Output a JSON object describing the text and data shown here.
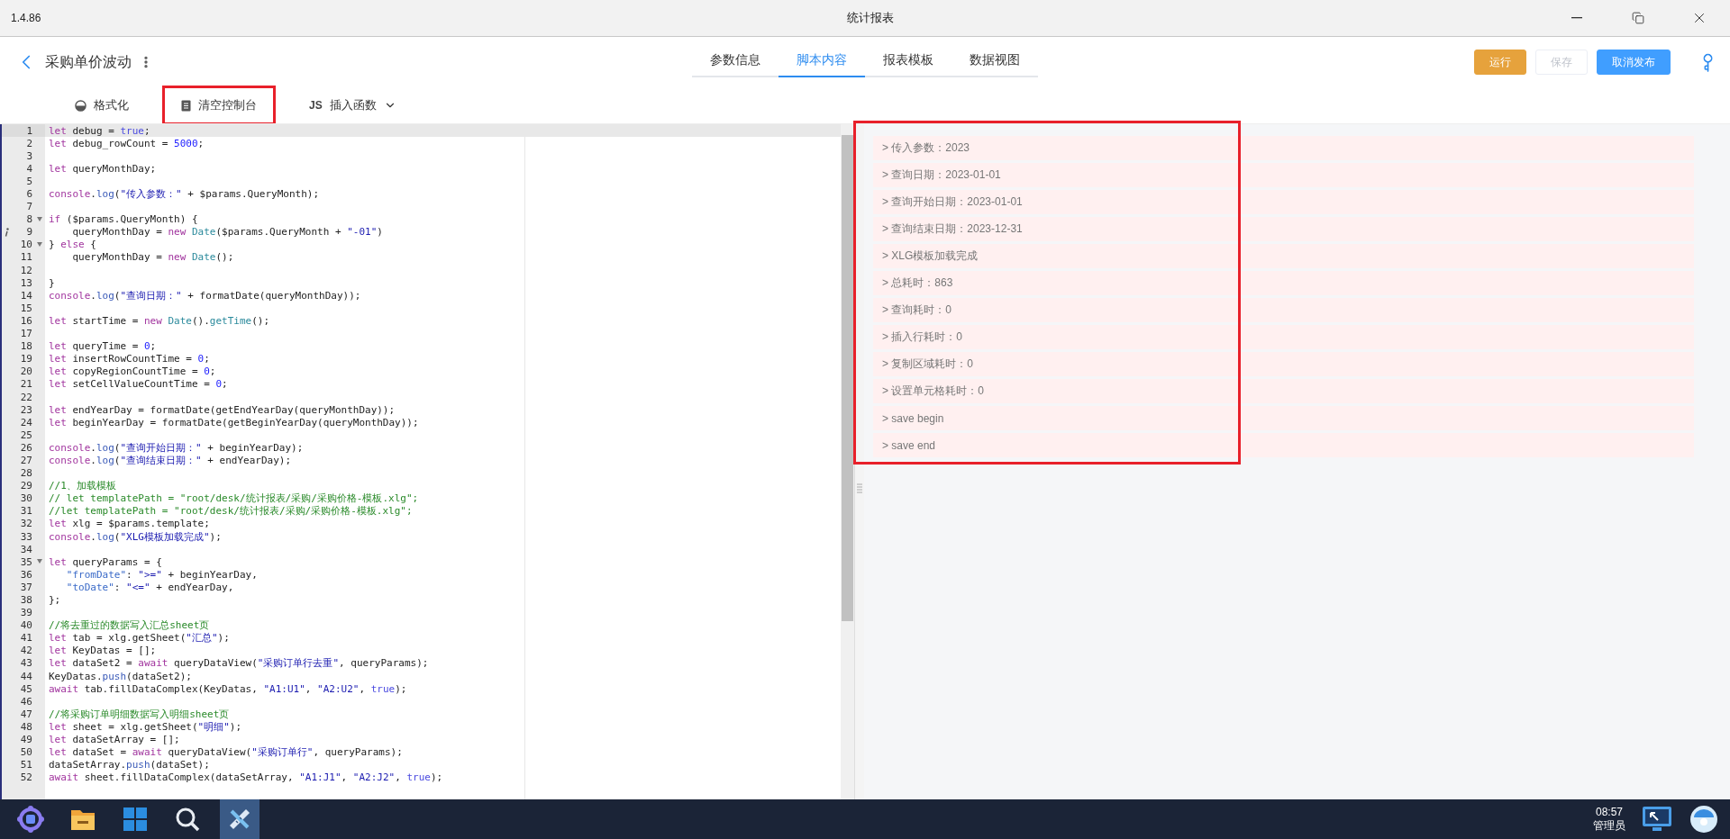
{
  "window": {
    "version": "1.4.86",
    "title": "统计报表"
  },
  "header": {
    "title": "采购单价波动"
  },
  "tabs": [
    {
      "label": "参数信息",
      "selected": false
    },
    {
      "label": "脚本内容",
      "selected": true
    },
    {
      "label": "报表模板",
      "selected": false
    },
    {
      "label": "数据视图",
      "selected": false
    }
  ],
  "actions": [
    {
      "label": "运行",
      "kind": "warning",
      "disabled": false
    },
    {
      "label": "保存",
      "kind": "plain",
      "disabled": true
    },
    {
      "label": "取消发布",
      "kind": "primary",
      "disabled": false
    }
  ],
  "toolbar": [
    {
      "kind": "format",
      "label": "格式化",
      "highlighted": false
    },
    {
      "kind": "clear",
      "label": "清空控制台",
      "highlighted": true
    },
    {
      "kind": "insert",
      "icon_text": "JS",
      "label": "插入函数",
      "highlighted": false
    }
  ],
  "code_lines": [
    {
      "number": "1",
      "active": true,
      "tokens": [
        {
          "kind": "kw",
          "text": "let"
        },
        {
          "kind": "txt",
          "text": " debug = "
        },
        {
          "kind": "atom",
          "text": "true"
        },
        {
          "kind": "txt",
          "text": ";"
        }
      ]
    },
    {
      "number": "2",
      "tokens": [
        {
          "kind": "kw",
          "text": "let"
        },
        {
          "kind": "txt",
          "text": " debug_rowCount = "
        },
        {
          "kind": "num",
          "text": "5000"
        },
        {
          "kind": "txt",
          "text": ";"
        }
      ]
    },
    {
      "number": "3"
    },
    {
      "number": "4",
      "tokens": [
        {
          "kind": "kw",
          "text": "let"
        },
        {
          "kind": "txt",
          "text": " queryMonthDay;"
        }
      ]
    },
    {
      "number": "5"
    },
    {
      "number": "6",
      "tokens": [
        {
          "kind": "kw",
          "text": "console"
        },
        {
          "kind": "txt",
          "text": "."
        },
        {
          "kind": "fn",
          "text": "log"
        },
        {
          "kind": "txt",
          "text": "("
        },
        {
          "kind": "str",
          "text": "\"传入参数：\""
        },
        {
          "kind": "txt",
          "text": " + $params.QueryMonth);"
        }
      ]
    },
    {
      "number": "7"
    },
    {
      "number": "8",
      "fold": true,
      "tokens": [
        {
          "kind": "kw",
          "text": "if"
        },
        {
          "kind": "txt",
          "text": " ($params.QueryMonth) {"
        }
      ]
    },
    {
      "number": "9",
      "info": true,
      "tokens": [
        {
          "kind": "txt",
          "text": "    queryMonthDay = "
        },
        {
          "kind": "kw",
          "text": "new"
        },
        {
          "kind": "cls",
          "text": " Date"
        },
        {
          "kind": "txt",
          "text": "($params.QueryMonth + "
        },
        {
          "kind": "str",
          "text": "\"-01\""
        },
        {
          "kind": "txt",
          "text": ")"
        }
      ]
    },
    {
      "number": "10",
      "fold": true,
      "tokens": [
        {
          "kind": "txt",
          "text": "} "
        },
        {
          "kind": "kw",
          "text": "else"
        },
        {
          "kind": "txt",
          "text": " {"
        }
      ]
    },
    {
      "number": "11",
      "tokens": [
        {
          "kind": "txt",
          "text": "    queryMonthDay = "
        },
        {
          "kind": "kw",
          "text": "new"
        },
        {
          "kind": "cls",
          "text": " Date"
        },
        {
          "kind": "txt",
          "text": "();"
        }
      ]
    },
    {
      "number": "12"
    },
    {
      "number": "13",
      "tokens": [
        {
          "kind": "txt",
          "text": "}"
        }
      ]
    },
    {
      "number": "14",
      "tokens": [
        {
          "kind": "kw",
          "text": "console"
        },
        {
          "kind": "txt",
          "text": "."
        },
        {
          "kind": "fn",
          "text": "log"
        },
        {
          "kind": "txt",
          "text": "("
        },
        {
          "kind": "str",
          "text": "\"查询日期：\""
        },
        {
          "kind": "txt",
          "text": " + formatDate(queryMonthDay));"
        }
      ]
    },
    {
      "number": "15"
    },
    {
      "number": "16",
      "tokens": [
        {
          "kind": "kw",
          "text": "let"
        },
        {
          "kind": "txt",
          "text": " startTime = "
        },
        {
          "kind": "kw",
          "text": "new"
        },
        {
          "kind": "cls",
          "text": " Date"
        },
        {
          "kind": "txt",
          "text": "()."
        },
        {
          "kind": "cls",
          "text": "getTime"
        },
        {
          "kind": "txt",
          "text": "();"
        }
      ]
    },
    {
      "number": "17"
    },
    {
      "number": "18",
      "tokens": [
        {
          "kind": "kw",
          "text": "let"
        },
        {
          "kind": "txt",
          "text": " queryTime = "
        },
        {
          "kind": "num",
          "text": "0"
        },
        {
          "kind": "txt",
          "text": ";"
        }
      ]
    },
    {
      "number": "19",
      "tokens": [
        {
          "kind": "kw",
          "text": "let"
        },
        {
          "kind": "txt",
          "text": " insertRowCountTime = "
        },
        {
          "kind": "num",
          "text": "0"
        },
        {
          "kind": "txt",
          "text": ";"
        }
      ]
    },
    {
      "number": "20",
      "tokens": [
        {
          "kind": "kw",
          "text": "let"
        },
        {
          "kind": "txt",
          "text": " copyRegionCountTime = "
        },
        {
          "kind": "num",
          "text": "0"
        },
        {
          "kind": "txt",
          "text": ";"
        }
      ]
    },
    {
      "number": "21",
      "tokens": [
        {
          "kind": "kw",
          "text": "let"
        },
        {
          "kind": "txt",
          "text": " setCellValueCountTime = "
        },
        {
          "kind": "num",
          "text": "0"
        },
        {
          "kind": "txt",
          "text": ";"
        }
      ]
    },
    {
      "number": "22"
    },
    {
      "number": "23",
      "tokens": [
        {
          "kind": "kw",
          "text": "let"
        },
        {
          "kind": "txt",
          "text": " endYearDay = formatDate(getEndYearDay(queryMonthDay));"
        }
      ]
    },
    {
      "number": "24",
      "tokens": [
        {
          "kind": "kw",
          "text": "let"
        },
        {
          "kind": "txt",
          "text": " beginYearDay = formatDate(getBeginYearDay(queryMonthDay));"
        }
      ]
    },
    {
      "number": "25"
    },
    {
      "number": "26",
      "tokens": [
        {
          "kind": "kw",
          "text": "console"
        },
        {
          "kind": "txt",
          "text": "."
        },
        {
          "kind": "fn",
          "text": "log"
        },
        {
          "kind": "txt",
          "text": "("
        },
        {
          "kind": "str",
          "text": "\"查询开始日期：\""
        },
        {
          "kind": "txt",
          "text": " + beginYearDay);"
        }
      ]
    },
    {
      "number": "27",
      "tokens": [
        {
          "kind": "kw",
          "text": "console"
        },
        {
          "kind": "txt",
          "text": "."
        },
        {
          "kind": "fn",
          "text": "log"
        },
        {
          "kind": "txt",
          "text": "("
        },
        {
          "kind": "str",
          "text": "\"查询结束日期：\""
        },
        {
          "kind": "txt",
          "text": " + endYearDay);"
        }
      ]
    },
    {
      "number": "28"
    },
    {
      "number": "29",
      "tokens": [
        {
          "kind": "cmt",
          "text": "//1、加载模板"
        }
      ]
    },
    {
      "number": "30",
      "tokens": [
        {
          "kind": "cmt",
          "text": "// let templatePath = \"root/desk/统计报表/采购/采购价格-模板.xlg\";"
        }
      ]
    },
    {
      "number": "31",
      "tokens": [
        {
          "kind": "cmt",
          "text": "//let templatePath = \"root/desk/统计报表/采购/采购价格-模板.xlg\";"
        }
      ]
    },
    {
      "number": "32",
      "tokens": [
        {
          "kind": "kw",
          "text": "let"
        },
        {
          "kind": "txt",
          "text": " xlg = $params.template;"
        }
      ]
    },
    {
      "number": "33",
      "tokens": [
        {
          "kind": "kw",
          "text": "console"
        },
        {
          "kind": "txt",
          "text": "."
        },
        {
          "kind": "fn",
          "text": "log"
        },
        {
          "kind": "txt",
          "text": "("
        },
        {
          "kind": "str",
          "text": "\"XLG模板加载完成\""
        },
        {
          "kind": "txt",
          "text": ");"
        }
      ]
    },
    {
      "number": "34"
    },
    {
      "number": "35",
      "fold": true,
      "tokens": [
        {
          "kind": "kw",
          "text": "let"
        },
        {
          "kind": "txt",
          "text": " queryParams = {"
        }
      ]
    },
    {
      "number": "36",
      "tokens": [
        {
          "kind": "key",
          "text": "   \"fromDate\""
        },
        {
          "kind": "txt",
          "text": ": "
        },
        {
          "kind": "str",
          "text": "\">=\""
        },
        {
          "kind": "txt",
          "text": " + beginYearDay,"
        }
      ]
    },
    {
      "number": "37",
      "tokens": [
        {
          "kind": "key",
          "text": "   \"toDate\""
        },
        {
          "kind": "txt",
          "text": ": "
        },
        {
          "kind": "str",
          "text": "\"<=\""
        },
        {
          "kind": "txt",
          "text": " + endYearDay,"
        }
      ]
    },
    {
      "number": "38",
      "tokens": [
        {
          "kind": "txt",
          "text": "};"
        }
      ]
    },
    {
      "number": "39"
    },
    {
      "number": "40",
      "tokens": [
        {
          "kind": "cmt",
          "text": "//将去重过的数据写入汇总sheet页"
        }
      ]
    },
    {
      "number": "41",
      "tokens": [
        {
          "kind": "kw",
          "text": "let"
        },
        {
          "kind": "txt",
          "text": " tab = xlg.getSheet("
        },
        {
          "kind": "str",
          "text": "\"汇总\""
        },
        {
          "kind": "txt",
          "text": ");"
        }
      ]
    },
    {
      "number": "42",
      "tokens": [
        {
          "kind": "kw",
          "text": "let"
        },
        {
          "kind": "txt",
          "text": " KeyDatas = [];"
        }
      ]
    },
    {
      "number": "43",
      "tokens": [
        {
          "kind": "kw",
          "text": "let"
        },
        {
          "kind": "txt",
          "text": " dataSet2 = "
        },
        {
          "kind": "kw",
          "text": "await"
        },
        {
          "kind": "txt",
          "text": " queryDataView("
        },
        {
          "kind": "str",
          "text": "\"采购订单行去重\""
        },
        {
          "kind": "txt",
          "text": ", queryParams);"
        }
      ]
    },
    {
      "number": "44",
      "tokens": [
        {
          "kind": "txt",
          "text": "KeyDatas."
        },
        {
          "kind": "fn",
          "text": "push"
        },
        {
          "kind": "txt",
          "text": "(dataSet2);"
        }
      ]
    },
    {
      "number": "45",
      "tokens": [
        {
          "kind": "kw",
          "text": "await"
        },
        {
          "kind": "txt",
          "text": " tab.fillDataComplex(KeyDatas, "
        },
        {
          "kind": "str",
          "text": "\"A1:U1\""
        },
        {
          "kind": "txt",
          "text": ", "
        },
        {
          "kind": "str",
          "text": "\"A2:U2\""
        },
        {
          "kind": "txt",
          "text": ", "
        },
        {
          "kind": "atom",
          "text": "true"
        },
        {
          "kind": "txt",
          "text": ");"
        }
      ]
    },
    {
      "number": "46"
    },
    {
      "number": "47",
      "tokens": [
        {
          "kind": "cmt",
          "text": "//将采购订单明细数据写入明细sheet页"
        }
      ]
    },
    {
      "number": "48",
      "tokens": [
        {
          "kind": "kw",
          "text": "let"
        },
        {
          "kind": "txt",
          "text": " sheet = xlg.getSheet("
        },
        {
          "kind": "str",
          "text": "\"明细\""
        },
        {
          "kind": "txt",
          "text": ");"
        }
      ]
    },
    {
      "number": "49",
      "tokens": [
        {
          "kind": "kw",
          "text": "let"
        },
        {
          "kind": "txt",
          "text": " dataSetArray = [];"
        }
      ]
    },
    {
      "number": "50",
      "tokens": [
        {
          "kind": "kw",
          "text": "let"
        },
        {
          "kind": "txt",
          "text": " dataSet = "
        },
        {
          "kind": "kw",
          "text": "await"
        },
        {
          "kind": "txt",
          "text": " queryDataView("
        },
        {
          "kind": "str",
          "text": "\"采购订单行\""
        },
        {
          "kind": "txt",
          "text": ", queryParams);"
        }
      ]
    },
    {
      "number": "51",
      "tokens": [
        {
          "kind": "txt",
          "text": "dataSetArray."
        },
        {
          "kind": "fn",
          "text": "push"
        },
        {
          "kind": "txt",
          "text": "(dataSet);"
        }
      ]
    },
    {
      "number": "52",
      "tokens": [
        {
          "kind": "kw",
          "text": "await"
        },
        {
          "kind": "txt",
          "text": " sheet.fillDataComplex(dataSetArray, "
        },
        {
          "kind": "str",
          "text": "\"A1:J1\""
        },
        {
          "kind": "txt",
          "text": ", "
        },
        {
          "kind": "str",
          "text": "\"A2:J2\""
        },
        {
          "kind": "txt",
          "text": ", "
        },
        {
          "kind": "atom",
          "text": "true"
        },
        {
          "kind": "txt",
          "text": ");"
        }
      ]
    }
  ],
  "console": {
    "highlighted": true,
    "lines": [
      "> 传入参数：2023",
      "> 查询日期：2023-01-01",
      "> 查询开始日期：2023-01-01",
      "> 查询结束日期：2023-12-31",
      "> XLG模板加载完成",
      "> 总耗时：863",
      "> 查询耗时：0",
      "> 插入行耗时：0",
      "> 复制区域耗时：0",
      "> 设置单元格耗时：0",
      "> save begin",
      "> save end"
    ]
  },
  "taskbar": {
    "apps": [
      {
        "kind": "hub",
        "selected": false
      },
      {
        "kind": "folder",
        "selected": false
      },
      {
        "kind": "grid",
        "selected": false
      },
      {
        "kind": "search",
        "selected": false
      },
      {
        "kind": "tool",
        "selected": true
      }
    ],
    "time": "08:57",
    "user": "管理员"
  }
}
